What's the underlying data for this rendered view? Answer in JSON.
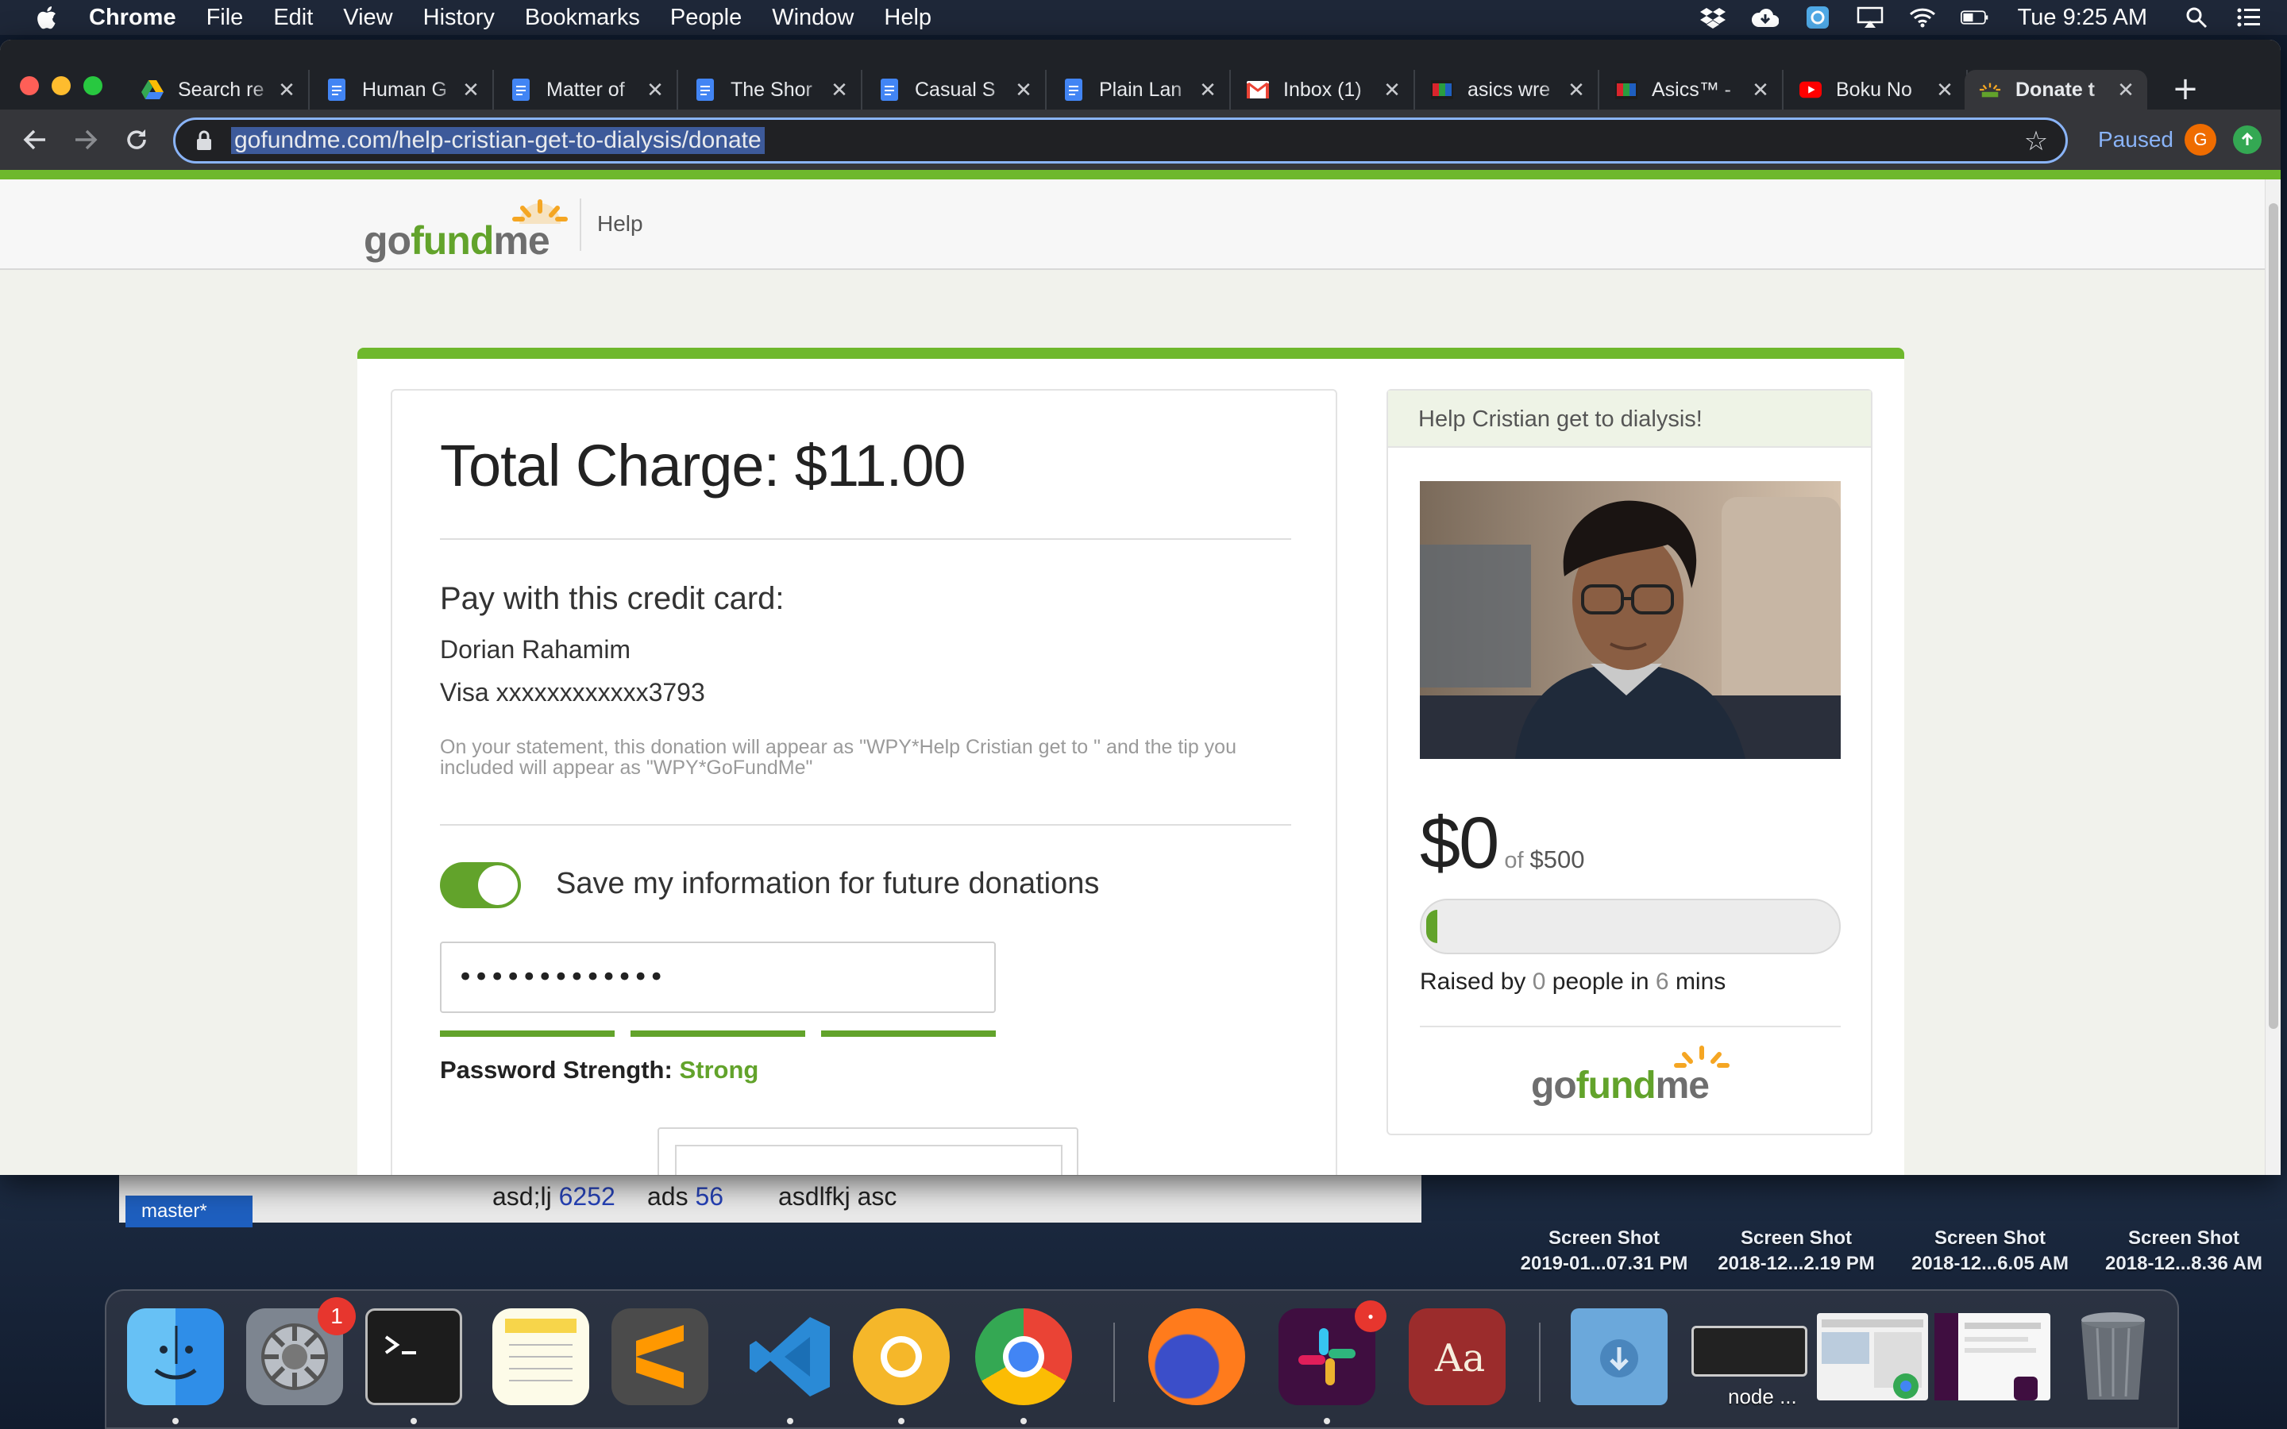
{
  "menubar": {
    "app_name": "Chrome",
    "menus": [
      "File",
      "Edit",
      "View",
      "History",
      "Bookmarks",
      "People",
      "Window",
      "Help"
    ],
    "clock": "Tue 9:25 AM"
  },
  "browser": {
    "tabs": [
      {
        "label": "Search re",
        "icon": "google-drive-icon"
      },
      {
        "label": "Human G",
        "icon": "google-docs-icon"
      },
      {
        "label": "Matter of",
        "icon": "google-docs-icon"
      },
      {
        "label": "The Shor",
        "icon": "google-docs-icon"
      },
      {
        "label": "Casual S",
        "icon": "google-docs-icon"
      },
      {
        "label": "Plain Lan",
        "icon": "google-docs-icon"
      },
      {
        "label": "Inbox (1)",
        "icon": "gmail-icon"
      },
      {
        "label": "asics wre",
        "icon": "asics-icon"
      },
      {
        "label": "Asics™ -",
        "icon": "asics-icon"
      },
      {
        "label": "Boku No",
        "icon": "youtube-icon"
      },
      {
        "label": "Donate t",
        "icon": "gofundme-icon",
        "active": true
      }
    ],
    "url": "gofundme.com/help-cristian-get-to-dialysis/donate",
    "profile_status": "Paused",
    "profile_initial": "G"
  },
  "site": {
    "logo_go": "go",
    "logo_fund": "fund",
    "logo_me": "me",
    "help_link": "Help"
  },
  "payment": {
    "total_charge": "Total Charge: $11.00",
    "pay_heading": "Pay with this credit card:",
    "card_name": "Dorian Rahamim",
    "card_number": "Visa xxxxxxxxxxxx3793",
    "statement_note": "On your statement, this donation will appear as \"WPY*Help Cristian get to \" and the tip you included will appear as \"WPY*GoFundMe\"",
    "save_info_label": "Save my information for future donations",
    "save_info_enabled": true,
    "password_value": "•••••••••••••",
    "password_strength_label": "Password Strength:",
    "password_strength_value": "Strong"
  },
  "campaign": {
    "title": "Help Cristian get to dialysis!",
    "raised_amount": "$0",
    "of_label": "of",
    "goal": "$500",
    "progress_fraction": 0.02,
    "raised_by_prefix": "Raised by",
    "people_count": "0",
    "raised_by_middle": "people in",
    "duration_num": "6",
    "duration_unit": "mins"
  },
  "desktop": {
    "files": [
      {
        "line1": "Screen Shot",
        "line2": "2019-01...07.31 PM"
      },
      {
        "line1": "Screen Shot",
        "line2": "2018-12...2.19 PM"
      },
      {
        "line1": "Screen Shot",
        "line2": "2018-12...6.05 AM"
      },
      {
        "line1": "Screen Shot",
        "line2": "2018-12...8.36 AM"
      }
    ],
    "behind_window": {
      "t1": "asd;lj",
      "n1": "6252",
      "t2": "ads",
      "n2": "56",
      "t3": "asdlfkj asc"
    },
    "git_branch": "master*"
  },
  "dock": {
    "apps": [
      "finder-icon",
      "system-preferences-icon",
      "terminal-icon",
      "notes-icon",
      "sublime-text-icon",
      "vscode-icon",
      "chrome-canary-icon",
      "chrome-icon",
      "firefox-icon",
      "slack-icon",
      "dictionary-icon",
      "downloads-folder-icon",
      "node-window-thumbnail",
      "screenshot-thumbnail",
      "slack-thumbnail",
      "trash-icon"
    ],
    "system_prefs_badge": "1",
    "node_label": "node ..."
  },
  "colors": {
    "gofundme_green": "#62a32b",
    "chrome_dark": "#35363a",
    "accent_blue": "#8ab4f8"
  }
}
